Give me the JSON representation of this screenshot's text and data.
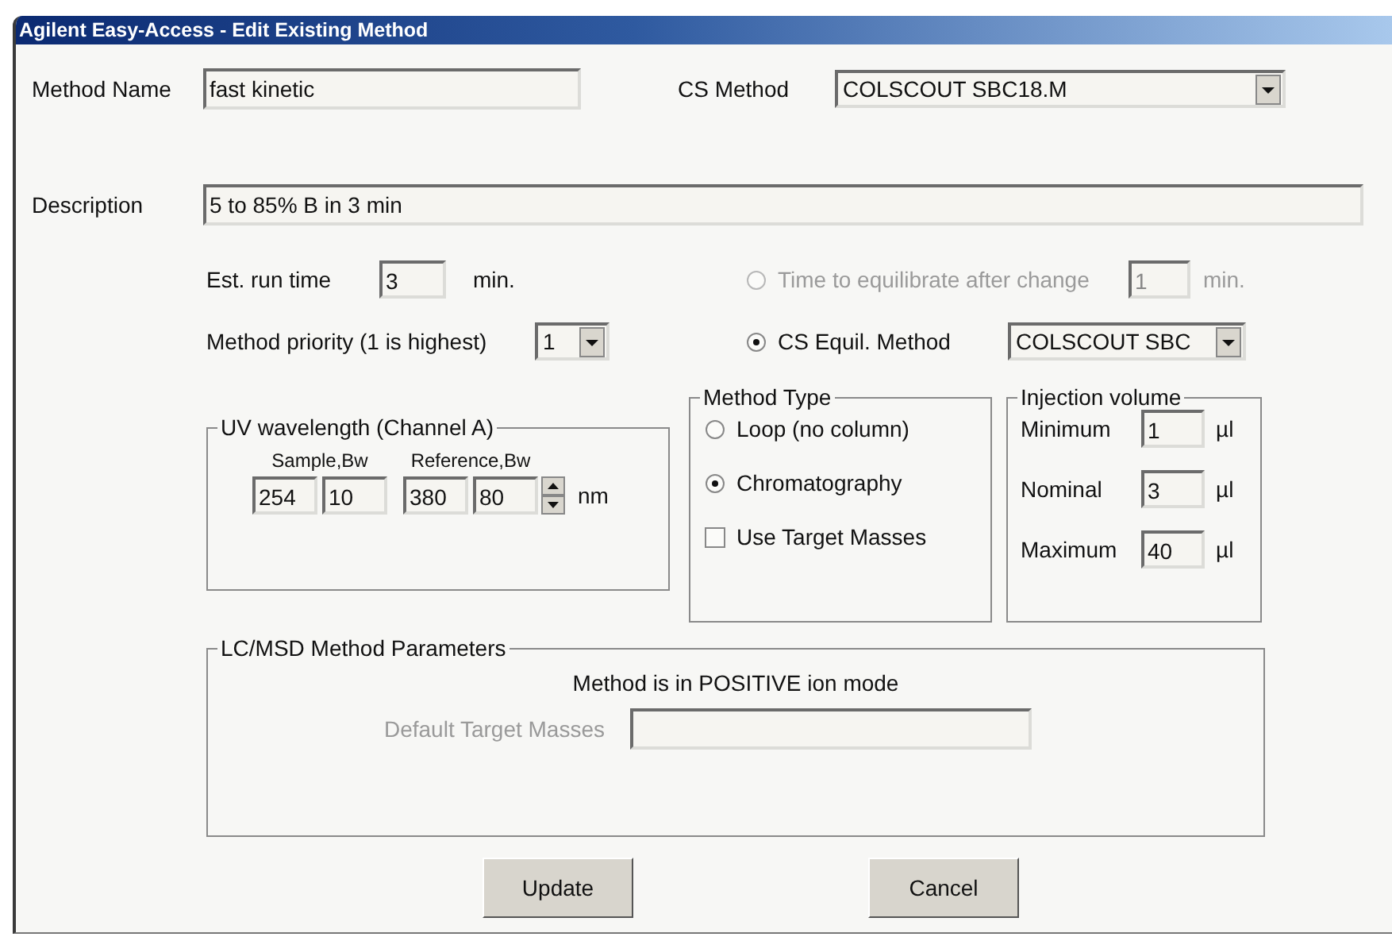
{
  "window": {
    "title": "Agilent Easy-Access - Edit Existing Method"
  },
  "method_name": {
    "label": "Method Name",
    "value": "fast kinetic"
  },
  "cs_method": {
    "label": "CS Method",
    "value": "COLSCOUT SBC18.M"
  },
  "description": {
    "label": "Description",
    "value": "5 to 85% B in 3 min"
  },
  "run_time": {
    "label": "Est. run time",
    "value": "3",
    "unit": "min."
  },
  "priority": {
    "label": "Method priority (1 is highest)",
    "value": "1"
  },
  "equilibration": [
    {
      "kind": "input",
      "label": "Time to equilibrate after change",
      "selected": false,
      "disabled": true,
      "value": "1",
      "unit": "min."
    },
    {
      "kind": "dropdown",
      "label": "CS Equil. Method",
      "selected": true,
      "disabled": false,
      "value": "COLSCOUT SBC"
    }
  ],
  "uv_wavelength": {
    "title": "UV wavelength (Channel A)",
    "unit": "nm",
    "columns": [
      {
        "heading": "Sample,Bw",
        "values": [
          "254",
          "10"
        ]
      },
      {
        "heading": "Reference,Bw",
        "values": [
          "380",
          "80"
        ]
      }
    ]
  },
  "method_type": {
    "title": "Method Type",
    "options": [
      {
        "kind": "radio",
        "label": "Loop (no column)",
        "selected": false
      },
      {
        "kind": "radio",
        "label": "Chromatography",
        "selected": true
      },
      {
        "kind": "checkbox",
        "label": "Use Target Masses",
        "checked": false
      }
    ]
  },
  "injection_volume": {
    "title": "Injection volume",
    "rows": [
      {
        "label": "Minimum",
        "value": "1",
        "unit": "µl"
      },
      {
        "label": "Nominal",
        "value": "3",
        "unit": "µl"
      },
      {
        "label": "Maximum",
        "value": "40",
        "unit": "µl"
      }
    ]
  },
  "lcmsd": {
    "title": "LC/MSD Method Parameters",
    "mode_text": "Method is in POSITIVE ion mode",
    "target_label": "Default Target Masses",
    "target_disabled": true
  },
  "buttons": [
    "Update",
    "Cancel"
  ]
}
